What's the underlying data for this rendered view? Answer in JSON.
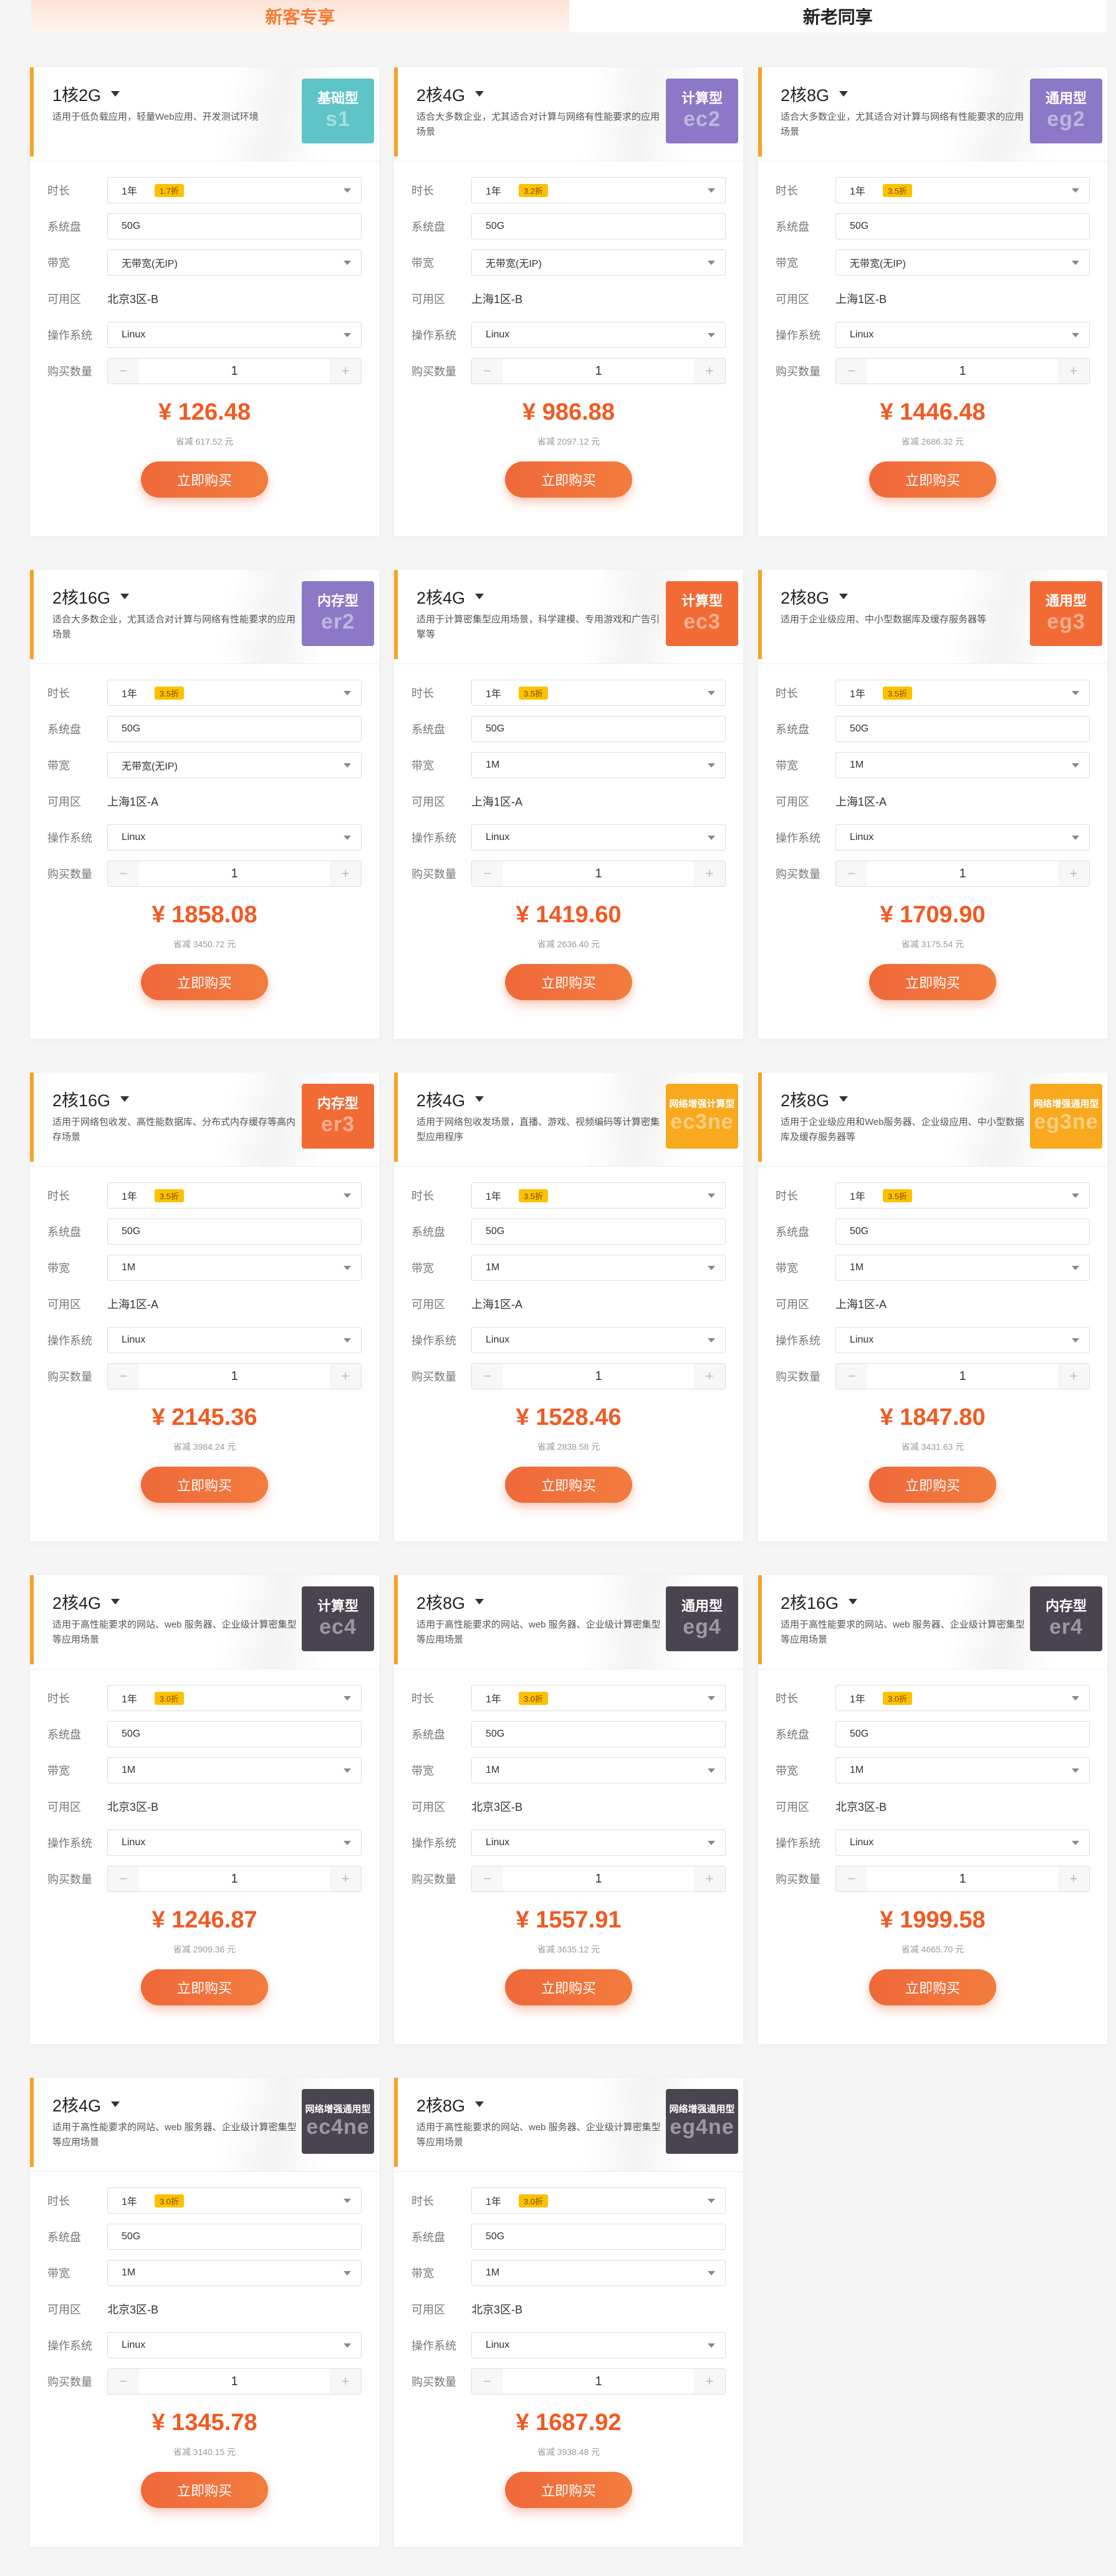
{
  "tabs": {
    "new_customer": "新客专享",
    "existing_customer": "新老同享"
  },
  "labels": {
    "duration": "时长",
    "disk": "系统盘",
    "bandwidth": "带宽",
    "zone": "可用区",
    "os": "操作系统",
    "quantity": "购买数量",
    "buy": "立即购买",
    "minus": "−",
    "plus": "+"
  },
  "colors": {
    "accent_orange": "#f15a22",
    "tab_active": "#f47a35",
    "discount_yellow": "#fdc100"
  },
  "cards": [
    {
      "config": "1核2G",
      "desc": "适用于低负载应用，轻量Web应用、开发测试环境",
      "type": "基础型",
      "code": "s1",
      "badge_color": "#5ec4c8",
      "duration": "1年",
      "discount": "1.7折",
      "disk": "50G",
      "bandwidth": "无带宽(无IP)",
      "zone": "北京3区-B",
      "os": "Linux",
      "qty": "1",
      "price": "¥ 126.48",
      "save": "省减 617.52 元"
    },
    {
      "config": "2核4G",
      "desc": "适合大多数企业，尤其适合对计算与网络有性能要求的应用场景",
      "type": "计算型",
      "code": "ec2",
      "badge_color": "#8b78c6",
      "duration": "1年",
      "discount": "3.2折",
      "disk": "50G",
      "bandwidth": "无带宽(无IP)",
      "zone": "上海1区-B",
      "os": "Linux",
      "qty": "1",
      "price": "¥ 986.88",
      "save": "省减 2097.12 元"
    },
    {
      "config": "2核8G",
      "desc": "适合大多数企业，尤其适合对计算与网络有性能要求的应用场景",
      "type": "通用型",
      "code": "eg2",
      "badge_color": "#8b78c6",
      "duration": "1年",
      "discount": "3.5折",
      "disk": "50G",
      "bandwidth": "无带宽(无IP)",
      "zone": "上海1区-B",
      "os": "Linux",
      "qty": "1",
      "price": "¥ 1446.48",
      "save": "省减 2686.32 元"
    },
    {
      "config": "2核16G",
      "desc": "适合大多数企业，尤其适合对计算与网络有性能要求的应用场景",
      "type": "内存型",
      "code": "er2",
      "badge_color": "#8b78c6",
      "duration": "1年",
      "discount": "3.5折",
      "disk": "50G",
      "bandwidth": "无带宽(无IP)",
      "zone": "上海1区-A",
      "os": "Linux",
      "qty": "1",
      "price": "¥ 1858.08",
      "save": "省减 3450.72 元"
    },
    {
      "config": "2核4G",
      "desc": "适用于计算密集型应用场景，科学建模、专用游戏和广告引擎等",
      "type": "计算型",
      "code": "ec3",
      "badge_color": "#f26b35",
      "duration": "1年",
      "discount": "3.5折",
      "disk": "50G",
      "bandwidth": "1M",
      "zone": "上海1区-A",
      "os": "Linux",
      "qty": "1",
      "price": "¥ 1419.60",
      "save": "省减 2636.40 元"
    },
    {
      "config": "2核8G",
      "desc": "适用于企业级应用、中小型数据库及缓存服务器等",
      "type": "通用型",
      "code": "eg3",
      "badge_color": "#f26b35",
      "duration": "1年",
      "discount": "3.5折",
      "disk": "50G",
      "bandwidth": "1M",
      "zone": "上海1区-A",
      "os": "Linux",
      "qty": "1",
      "price": "¥ 1709.90",
      "save": "省减 3175.54 元"
    },
    {
      "config": "2核16G",
      "desc": "适用于网络包收发、高性能数据库、分布式内存缓存等高内存场景",
      "type": "内存型",
      "code": "er3",
      "badge_color": "#f26b35",
      "duration": "1年",
      "discount": "3.5折",
      "disk": "50G",
      "bandwidth": "1M",
      "zone": "上海1区-A",
      "os": "Linux",
      "qty": "1",
      "price": "¥ 2145.36",
      "save": "省减 3984.24 元"
    },
    {
      "config": "2核4G",
      "desc": "适用于网络包收发场景，直播、游戏、视频编码等计算密集型应用程序",
      "type": "网络增强计算型",
      "code": "ec3ne",
      "badge_color": "#f8a91e",
      "duration": "1年",
      "discount": "3.5折",
      "disk": "50G",
      "bandwidth": "1M",
      "zone": "上海1区-A",
      "os": "Linux",
      "qty": "1",
      "price": "¥ 1528.46",
      "save": "省减 2838.58 元"
    },
    {
      "config": "2核8G",
      "desc": "适用于企业级应用和Web服务器、企业级应用、中小型数据库及缓存服务器等",
      "type": "网络增强通用型",
      "code": "eg3ne",
      "badge_color": "#f8a91e",
      "duration": "1年",
      "discount": "3.5折",
      "disk": "50G",
      "bandwidth": "1M",
      "zone": "上海1区-A",
      "os": "Linux",
      "qty": "1",
      "price": "¥ 1847.80",
      "save": "省减 3431.63 元"
    },
    {
      "config": "2核4G",
      "desc": "适用于高性能要求的网站、web 服务器、企业级计算密集型等应用场景",
      "type": "计算型",
      "code": "ec4",
      "badge_color": "#4a4450",
      "duration": "1年",
      "discount": "3.0折",
      "disk": "50G",
      "bandwidth": "1M",
      "zone": "北京3区-B",
      "os": "Linux",
      "qty": "1",
      "price": "¥ 1246.87",
      "save": "省减 2909.36 元"
    },
    {
      "config": "2核8G",
      "desc": "适用于高性能要求的网站、web 服务器、企业级计算密集型等应用场景",
      "type": "通用型",
      "code": "eg4",
      "badge_color": "#4a4450",
      "duration": "1年",
      "discount": "3.0折",
      "disk": "50G",
      "bandwidth": "1M",
      "zone": "北京3区-B",
      "os": "Linux",
      "qty": "1",
      "price": "¥ 1557.91",
      "save": "省减 3635.12 元"
    },
    {
      "config": "2核16G",
      "desc": "适用于高性能要求的网站、web 服务器、企业级计算密集型等应用场景",
      "type": "内存型",
      "code": "er4",
      "badge_color": "#4a4450",
      "duration": "1年",
      "discount": "3.0折",
      "disk": "50G",
      "bandwidth": "1M",
      "zone": "北京3区-B",
      "os": "Linux",
      "qty": "1",
      "price": "¥ 1999.58",
      "save": "省减 4665.70 元"
    },
    {
      "config": "2核4G",
      "desc": "适用于高性能要求的网站、web 服务器、企业级计算密集型等应用场景",
      "type": "网络增强通用型",
      "code": "ec4ne",
      "badge_color": "#4a4450",
      "duration": "1年",
      "discount": "3.0折",
      "disk": "50G",
      "bandwidth": "1M",
      "zone": "北京3区-B",
      "os": "Linux",
      "qty": "1",
      "price": "¥ 1345.78",
      "save": "省减 3140.15 元"
    },
    {
      "config": "2核8G",
      "desc": "适用于高性能要求的网站、web 服务器、企业级计算密集型等应用场景",
      "type": "网络增强通用型",
      "code": "eg4ne",
      "badge_color": "#4a4450",
      "duration": "1年",
      "discount": "3.0折",
      "disk": "50G",
      "bandwidth": "1M",
      "zone": "北京3区-B",
      "os": "Linux",
      "qty": "1",
      "price": "¥ 1687.92",
      "save": "省减 3938.48 元"
    }
  ]
}
